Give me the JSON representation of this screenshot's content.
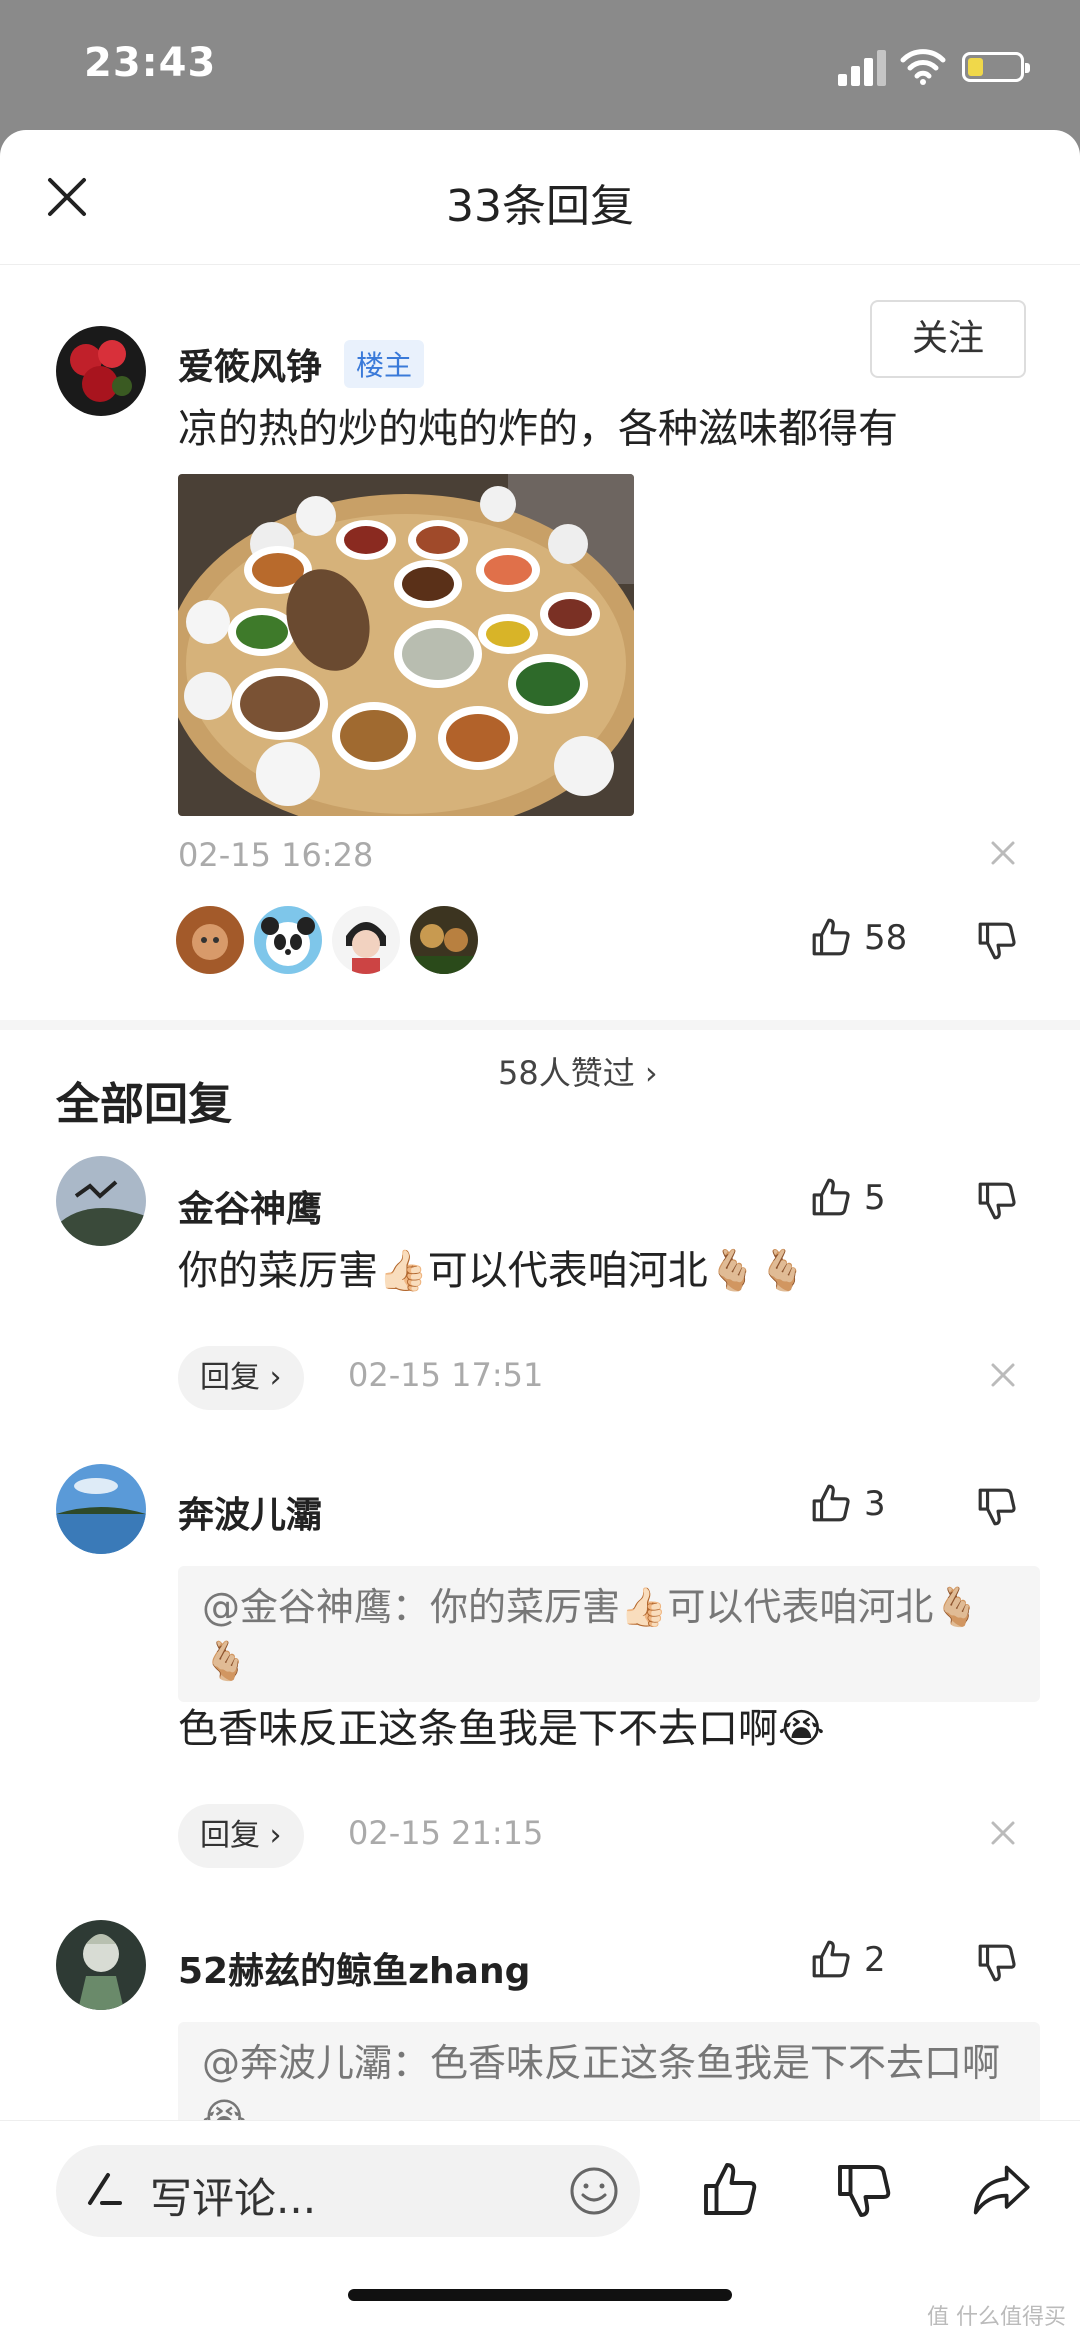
{
  "status_bar": {
    "time": "23:43",
    "battery_level": 0.3
  },
  "sheet": {
    "title": "33条回复"
  },
  "post": {
    "author": "爱筱风铮",
    "badge": "楼主",
    "follow_label": "关注",
    "text": "凉的热的炒的炖的炸的，各种滋味都得有",
    "time": "02-15 16:28",
    "likers_text": "58人赞过 ›",
    "like_count": "58"
  },
  "section": {
    "title": "全部回复"
  },
  "replies": [
    {
      "author": "金谷神鹰",
      "like_count": "5",
      "text": "你的菜厉害👍🏻可以代表咱河北🫰🏼🫰🏼",
      "reply_label": "回复 ›",
      "time": "02-15 17:51"
    },
    {
      "author": "奔波儿灞",
      "like_count": "3",
      "quote": "@金谷神鹰：你的菜厉害👍🏻可以代表咱河北🫰🏼🫰🏼",
      "text": "色香味反正这条鱼我是下不去口啊😭",
      "reply_label": "回复 ›",
      "time": "02-15 21:15"
    },
    {
      "author": "52赫兹的鲸鱼zhang",
      "like_count": "2",
      "quote": "@奔波儿灞：色香味反正这条鱼我是下不去口啊😭"
    }
  ],
  "bottom_bar": {
    "comment_placeholder": "写评论..."
  },
  "watermark": "值 什么值得买"
}
